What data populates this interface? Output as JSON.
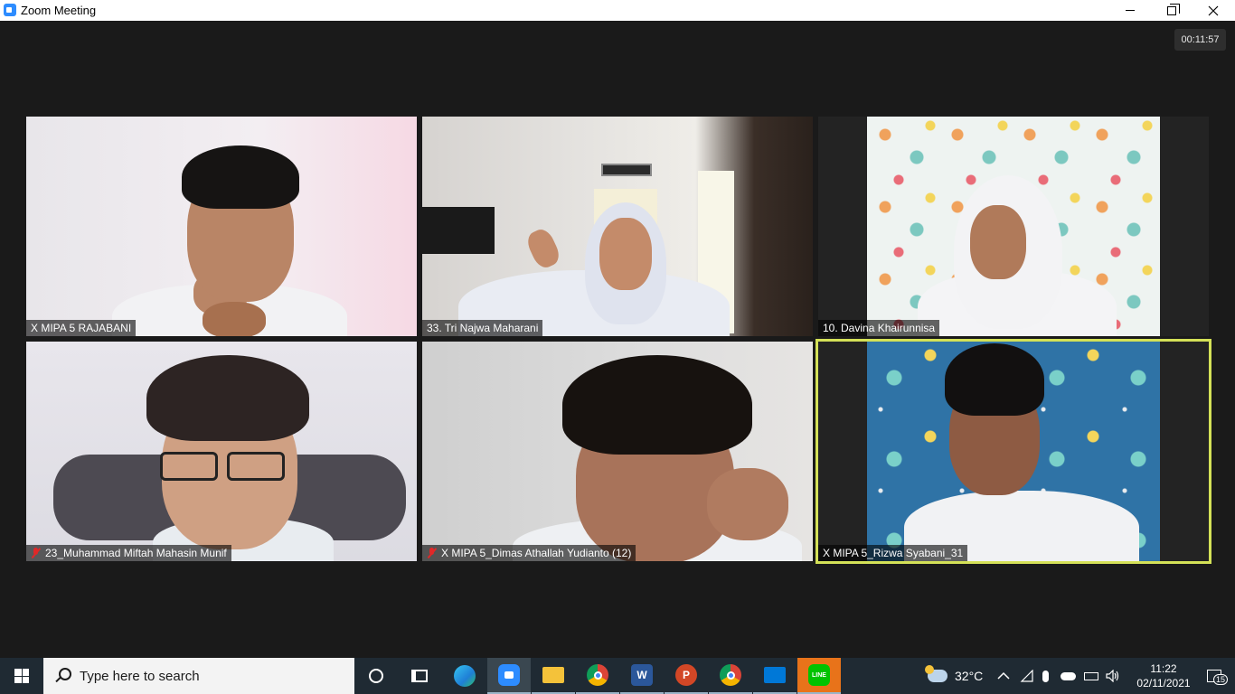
{
  "window": {
    "title": "Zoom Meeting"
  },
  "meeting": {
    "timer": "00:11:57"
  },
  "participants": [
    {
      "name": "X MIPA 5 RAJABANI",
      "muted": false
    },
    {
      "name": "33. Tri Najwa Maharani",
      "muted": false
    },
    {
      "name": "10. Davina Khairunnisa",
      "muted": false
    },
    {
      "name": "23_Muhammad Miftah Mahasin Munif",
      "muted": true
    },
    {
      "name": "X MIPA 5_Dimas Athallah Yudianto (12)",
      "muted": true
    },
    {
      "name": "X MIPA 5_Rizwa Syabani_31",
      "muted": false,
      "active_speaker": true
    }
  ],
  "taskbar": {
    "search_placeholder": "Type here to search",
    "apps": [
      "task-view",
      "edge",
      "zoom",
      "file-explorer",
      "chrome",
      "word",
      "powerpoint",
      "chrome",
      "photos",
      "line"
    ],
    "weather": "32°C",
    "time": "11:22",
    "date": "02/11/2021",
    "notifications": "15"
  },
  "colors": {
    "active_speaker_border": "#d4e157",
    "muted_icon": "#e02828",
    "zoom_blue": "#2d8cff"
  }
}
